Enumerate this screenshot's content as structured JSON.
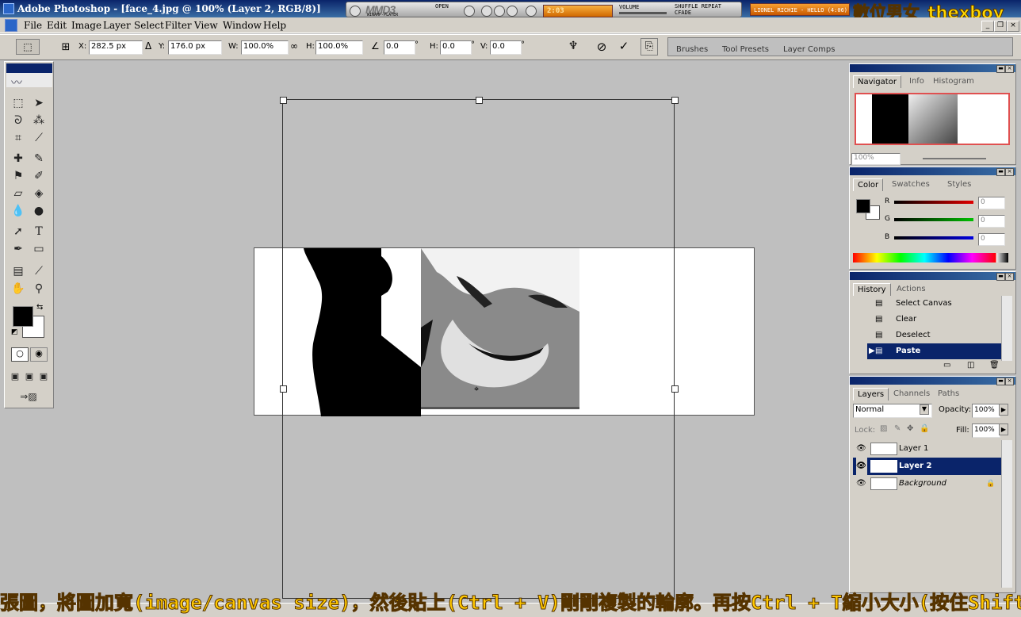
{
  "window": {
    "title": "Adobe Photoshop - [face_4.jpg @ 100% (Layer 2, RGB/8)]"
  },
  "player": {
    "logo": "MMD3",
    "sublabel": "WINAMP-PLAYER",
    "open": "OPEN",
    "display": "2:03",
    "volume": "VOLUME",
    "shuffle_repeat": "SHUFFLE REPEAT CFADE",
    "track": "LIONEL RICHIE - HELLO (4:06)"
  },
  "watermark": "數位男女_thexboy",
  "menubar": {
    "items": [
      "File",
      "Edit",
      "Image",
      "Layer",
      "Select",
      "Filter",
      "View",
      "Window",
      "Help"
    ]
  },
  "options": {
    "x_label": "X:",
    "x_value": "282.5 px",
    "y_label": "Y:",
    "y_value": "176.0 px",
    "w_label": "W:",
    "w_value": "100.0%",
    "h_label": "H:",
    "h_value": "100.0%",
    "angle_value": "0.0",
    "hskew_label": "H:",
    "hskew_value": "0.0",
    "vskew_label": "V:",
    "vskew_value": "0.0",
    "degree": "°"
  },
  "palette_well": {
    "tabs": [
      "Brushes",
      "Tool Presets",
      "Layer Comps"
    ]
  },
  "navigator": {
    "tabs": [
      "Navigator",
      "Info",
      "Histogram"
    ],
    "zoom": "100%"
  },
  "color": {
    "tabs": [
      "Color",
      "Swatches",
      "Styles"
    ],
    "r_label": "R",
    "g_label": "G",
    "b_label": "B",
    "r_value": "0",
    "g_value": "0",
    "b_value": "0",
    "r_color": "#e00000",
    "g_color": "#00c000",
    "b_color": "#0000e0"
  },
  "history": {
    "tabs": [
      "History",
      "Actions"
    ],
    "items": [
      "Select Canvas",
      "Clear",
      "Deselect",
      "Paste"
    ]
  },
  "layers": {
    "tabs": [
      "Layers",
      "Channels",
      "Paths"
    ],
    "blend_mode": "Normal",
    "opacity_label": "Opacity:",
    "opacity": "100%",
    "lock_label": "Lock:",
    "fill_label": "Fill:",
    "fill": "100%",
    "items": [
      "Layer 1",
      "Layer 2",
      "Background"
    ]
  },
  "subtitle": "張圖，將圖加寬(image/canvas size)，然後貼上(Ctrl + V)剛剛複製的輪廓。再按Ctrl + T縮小大小(按住Shift"
}
